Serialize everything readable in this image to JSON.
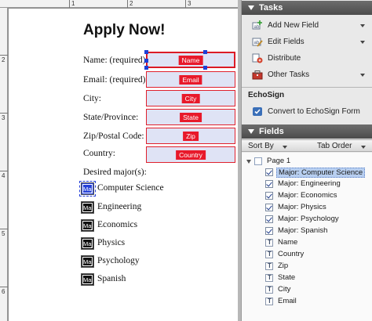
{
  "document": {
    "title": "Apply Now!",
    "ruler_top_numbers": [
      "1",
      "2",
      "3"
    ],
    "ruler_left_numbers": [
      "2",
      "3",
      "4",
      "5",
      "6"
    ],
    "labels": {
      "name": "Name: (required)",
      "email": "Email: (required)",
      "city": "City:",
      "state": "State/Province:",
      "zip": "Zip/Postal Code:",
      "country": "Country:",
      "majors": "Desired major(s):"
    },
    "text_fields": [
      {
        "tag": "Name",
        "selected": true
      },
      {
        "tag": "Email",
        "selected": false
      },
      {
        "tag": "City",
        "selected": false
      },
      {
        "tag": "State",
        "selected": false
      },
      {
        "tag": "Zip",
        "selected": false
      },
      {
        "tag": "Country",
        "selected": false
      }
    ],
    "checkbox_tag": "Maj",
    "checkboxes": [
      {
        "label": "Computer Science",
        "selected": true
      },
      {
        "label": "Engineering",
        "selected": false
      },
      {
        "label": "Economics",
        "selected": false
      },
      {
        "label": "Physics",
        "selected": false
      },
      {
        "label": "Psychology",
        "selected": false
      },
      {
        "label": "Spanish",
        "selected": false
      }
    ]
  },
  "task_pane": {
    "tasks_header": "Tasks",
    "tasks": [
      {
        "label": "Add New Field",
        "icon": "add-field-icon",
        "has_menu": true
      },
      {
        "label": "Edit Fields",
        "icon": "edit-fields-icon",
        "has_menu": true
      },
      {
        "label": "Distribute",
        "icon": "distribute-icon",
        "has_menu": false
      },
      {
        "label": "Other Tasks",
        "icon": "toolbox-icon",
        "has_menu": true
      }
    ],
    "echosign_label": "EchoSign",
    "echosign_task": "Convert to EchoSign Form",
    "fields_header": "Fields",
    "sort_by": "Sort By",
    "tab_order": "Tab Order",
    "tree_root": "Page 1",
    "tree_items": [
      {
        "label": "Major: Computer Science",
        "kind": "checkbox",
        "selected": true
      },
      {
        "label": "Major: Engineering",
        "kind": "checkbox",
        "selected": false
      },
      {
        "label": "Major: Economics",
        "kind": "checkbox",
        "selected": false
      },
      {
        "label": "Major: Physics",
        "kind": "checkbox",
        "selected": false
      },
      {
        "label": "Major: Psychology",
        "kind": "checkbox",
        "selected": false
      },
      {
        "label": "Major: Spanish",
        "kind": "checkbox",
        "selected": false
      },
      {
        "label": "Name",
        "kind": "text",
        "selected": false
      },
      {
        "label": "Country",
        "kind": "text",
        "selected": false
      },
      {
        "label": "Zip",
        "kind": "text",
        "selected": false
      },
      {
        "label": "State",
        "kind": "text",
        "selected": false
      },
      {
        "label": "City",
        "kind": "text",
        "selected": false
      },
      {
        "label": "Email",
        "kind": "text",
        "selected": false
      }
    ]
  },
  "colors": {
    "field_border": "#e0202c",
    "field_fill": "#dfe3f5",
    "selection_blue": "#2742d8",
    "pane_header": "#555555",
    "tree_selection": "#b8cff0"
  }
}
